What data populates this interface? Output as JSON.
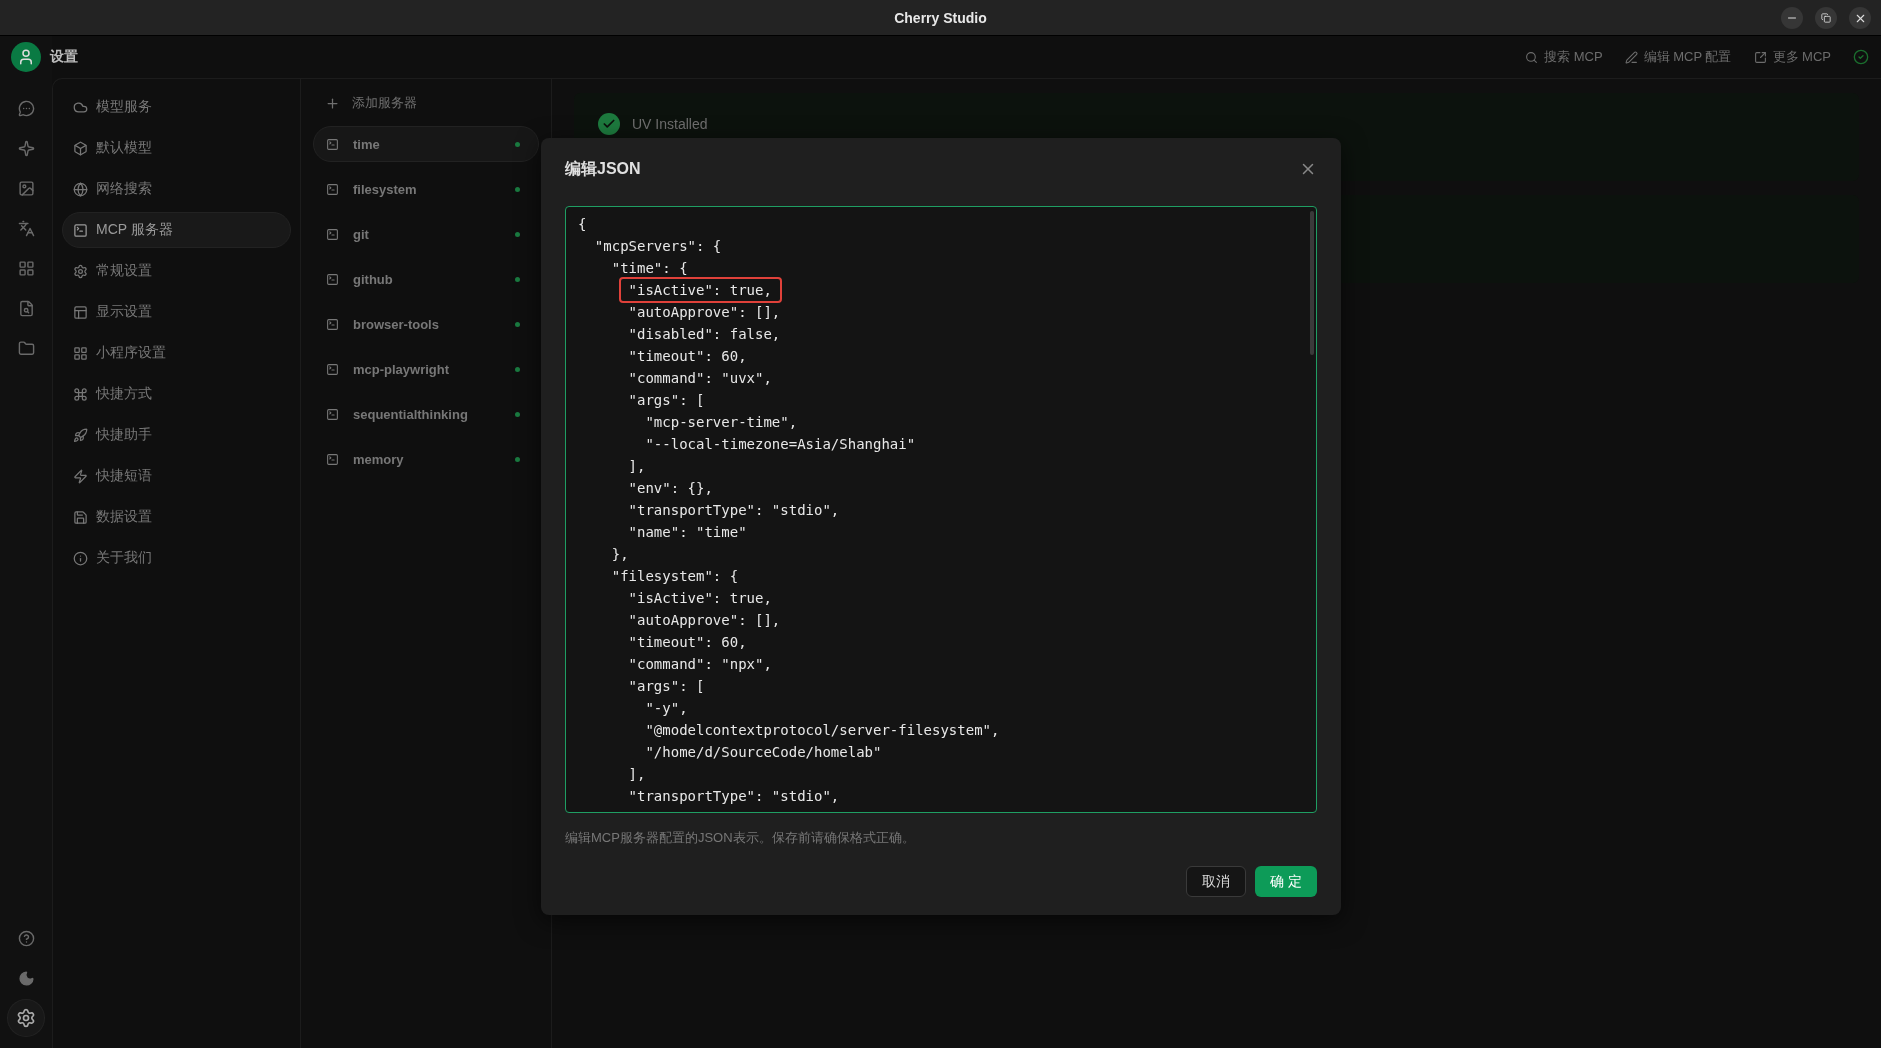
{
  "window": {
    "title": "Cherry Studio"
  },
  "header": {
    "title": "设置",
    "actions": [
      {
        "kind": "search",
        "label": "搜索 MCP"
      },
      {
        "kind": "edit",
        "label": "编辑 MCP 配置"
      },
      {
        "kind": "external",
        "label": "更多 MCP"
      }
    ]
  },
  "rail": {
    "top": [
      {
        "kind": "chat",
        "selected": false
      },
      {
        "kind": "sparkle",
        "selected": false
      },
      {
        "kind": "image",
        "selected": false
      },
      {
        "kind": "translate",
        "selected": false
      },
      {
        "kind": "apps",
        "selected": false
      },
      {
        "kind": "docsearch",
        "selected": false
      },
      {
        "kind": "folder",
        "selected": false
      }
    ],
    "bottom": [
      {
        "kind": "help",
        "selected": false
      },
      {
        "kind": "theme",
        "selected": false
      },
      {
        "kind": "settings",
        "selected": true
      }
    ]
  },
  "settings_menu": [
    {
      "kind": "cloud",
      "label": "模型服务",
      "selected": false
    },
    {
      "kind": "cube",
      "label": "默认模型",
      "selected": false
    },
    {
      "kind": "globe",
      "label": "网络搜索",
      "selected": false
    },
    {
      "kind": "terminal",
      "label": "MCP 服务器",
      "selected": true
    },
    {
      "kind": "gear",
      "label": "常规设置",
      "selected": false
    },
    {
      "kind": "layout",
      "label": "显示设置",
      "selected": false
    },
    {
      "kind": "grid",
      "label": "小程序设置",
      "selected": false
    },
    {
      "kind": "command",
      "label": "快捷方式",
      "selected": false
    },
    {
      "kind": "rocket",
      "label": "快捷助手",
      "selected": false
    },
    {
      "kind": "zap",
      "label": "快捷短语",
      "selected": false
    },
    {
      "kind": "save",
      "label": "数据设置",
      "selected": false
    },
    {
      "kind": "info",
      "label": "关于我们",
      "selected": false
    }
  ],
  "servers": {
    "add_label": "添加服务器",
    "items": [
      {
        "name": "time",
        "active": true,
        "selected": true
      },
      {
        "name": "filesystem",
        "active": true,
        "selected": false
      },
      {
        "name": "git",
        "active": true,
        "selected": false
      },
      {
        "name": "github",
        "active": true,
        "selected": false
      },
      {
        "name": "browser-tools",
        "active": true,
        "selected": false
      },
      {
        "name": "mcp-playwright",
        "active": true,
        "selected": false
      },
      {
        "name": "sequentialthinking",
        "active": true,
        "selected": false
      },
      {
        "name": "memory",
        "active": true,
        "selected": false
      }
    ]
  },
  "status": {
    "label": "UV Installed"
  },
  "dialog": {
    "title": "编辑JSON",
    "lines": [
      {
        "text": "{",
        "highlighted": false
      },
      {
        "text": "  \"mcpServers\": {",
        "highlighted": false
      },
      {
        "text": "    \"time\": {",
        "highlighted": false
      },
      {
        "text": "      \"isActive\": true,",
        "highlighted": true
      },
      {
        "text": "      \"autoApprove\": [],",
        "highlighted": false
      },
      {
        "text": "      \"disabled\": false,",
        "highlighted": false
      },
      {
        "text": "      \"timeout\": 60,",
        "highlighted": false
      },
      {
        "text": "      \"command\": \"uvx\",",
        "highlighted": false
      },
      {
        "text": "      \"args\": [",
        "highlighted": false
      },
      {
        "text": "        \"mcp-server-time\",",
        "highlighted": false
      },
      {
        "text": "        \"--local-timezone=Asia/Shanghai\"",
        "highlighted": false
      },
      {
        "text": "      ],",
        "highlighted": false
      },
      {
        "text": "      \"env\": {},",
        "highlighted": false
      },
      {
        "text": "      \"transportType\": \"stdio\",",
        "highlighted": false
      },
      {
        "text": "      \"name\": \"time\"",
        "highlighted": false
      },
      {
        "text": "    },",
        "highlighted": false
      },
      {
        "text": "    \"filesystem\": {",
        "highlighted": false
      },
      {
        "text": "      \"isActive\": true,",
        "highlighted": false
      },
      {
        "text": "      \"autoApprove\": [],",
        "highlighted": false
      },
      {
        "text": "      \"timeout\": 60,",
        "highlighted": false
      },
      {
        "text": "      \"command\": \"npx\",",
        "highlighted": false
      },
      {
        "text": "      \"args\": [",
        "highlighted": false
      },
      {
        "text": "        \"-y\",",
        "highlighted": false
      },
      {
        "text": "        \"@modelcontextprotocol/server-filesystem\",",
        "highlighted": false
      },
      {
        "text": "        \"/home/d/SourceCode/homelab\"",
        "highlighted": false
      },
      {
        "text": "      ],",
        "highlighted": false
      },
      {
        "text": "      \"transportType\": \"stdio\",",
        "highlighted": false
      }
    ],
    "hint": "编辑MCP服务器配置的JSON表示。保存前请确保格式正确。",
    "buttons": [
      {
        "kind": "secondary",
        "label": "取消"
      },
      {
        "kind": "primary",
        "label": "确 定"
      }
    ]
  }
}
